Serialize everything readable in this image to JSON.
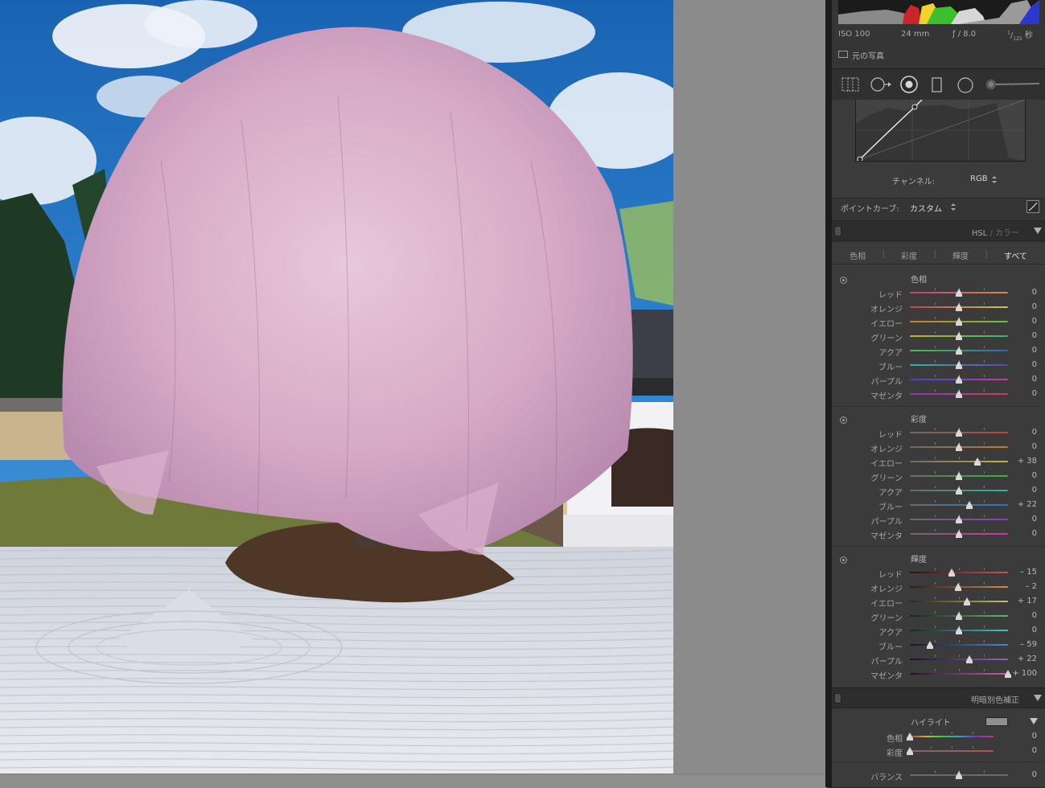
{
  "info": {
    "iso": "ISO 100",
    "focal": "24 mm",
    "aperture": "ƒ / 8.0",
    "shutter_num": "1",
    "shutter_den": "125",
    "shutter_unit": "秒",
    "original_label": "元の写真"
  },
  "tone_curve": {
    "channel_label": "チャンネル:",
    "channel_value": "RGB",
    "point_curve_label": "ポイントカーブ:",
    "point_curve_value": "カスタム"
  },
  "hsl": {
    "title_hsl": "HSL",
    "title_sep": " / ",
    "title_color": "カラー",
    "tabs": [
      "色相",
      "彩度",
      "輝度",
      "すべて"
    ],
    "groups": [
      {
        "title": "色相",
        "rows": [
          {
            "name": "レッド",
            "value": "0",
            "level": 0,
            "grad": [
              "#c23a7c",
              "#d98b3a"
            ]
          },
          {
            "name": "オレンジ",
            "value": "0",
            "level": 0,
            "grad": [
              "#c83a55",
              "#d9c23a"
            ]
          },
          {
            "name": "イエロー",
            "value": "0",
            "level": 0,
            "grad": [
              "#d07a2c",
              "#6cc23a"
            ]
          },
          {
            "name": "グリーン",
            "value": "0",
            "level": 0,
            "grad": [
              "#c9b22c",
              "#2cb87a"
            ]
          },
          {
            "name": "アクア",
            "value": "0",
            "level": 0,
            "grad": [
              "#4cc23a",
              "#2c66c2"
            ]
          },
          {
            "name": "ブルー",
            "value": "0",
            "level": 0,
            "grad": [
              "#2cb8a8",
              "#6a3ac2"
            ]
          },
          {
            "name": "パープル",
            "value": "0",
            "level": 0,
            "grad": [
              "#3a4ac2",
              "#c23aa2"
            ]
          },
          {
            "name": "マゼンタ",
            "value": "0",
            "level": 0,
            "grad": [
              "#8a3ac2",
              "#d23a5a"
            ]
          }
        ]
      },
      {
        "title": "彩度",
        "rows": [
          {
            "name": "レッド",
            "value": "0",
            "level": 0,
            "grad": [
              "#6a6a6a",
              "#c2443a"
            ]
          },
          {
            "name": "オレンジ",
            "value": "0",
            "level": 0,
            "grad": [
              "#6a6a6a",
              "#c8782c"
            ]
          },
          {
            "name": "イエロー",
            "value": "+ 38",
            "level": 38,
            "grad": [
              "#6a6a6a",
              "#c8b42c"
            ]
          },
          {
            "name": "グリーン",
            "value": "0",
            "level": 0,
            "grad": [
              "#6a6a6a",
              "#3cb43a"
            ]
          },
          {
            "name": "アクア",
            "value": "0",
            "level": 0,
            "grad": [
              "#6a6a6a",
              "#2cb49e"
            ]
          },
          {
            "name": "ブルー",
            "value": "+ 22",
            "level": 22,
            "grad": [
              "#6a6a6a",
              "#2c72c8"
            ]
          },
          {
            "name": "パープル",
            "value": "0",
            "level": 0,
            "grad": [
              "#6a6a6a",
              "#8a3ac8"
            ]
          },
          {
            "name": "マゼンタ",
            "value": "0",
            "level": 0,
            "grad": [
              "#6a6a6a",
              "#c83aa0"
            ]
          }
        ]
      },
      {
        "title": "輝度",
        "rows": [
          {
            "name": "レッド",
            "value": "– 15",
            "level": -15,
            "grad": [
              "#2a1212",
              "#c25a5a"
            ]
          },
          {
            "name": "オレンジ",
            "value": "– 2",
            "level": -2,
            "grad": [
              "#2a1e10",
              "#d09048"
            ]
          },
          {
            "name": "イエロー",
            "value": "+ 17",
            "level": 17,
            "grad": [
              "#2a2810",
              "#cec25a"
            ]
          },
          {
            "name": "グリーン",
            "value": "0",
            "level": 0,
            "grad": [
              "#122a12",
              "#5ac25a"
            ]
          },
          {
            "name": "アクア",
            "value": "0",
            "level": 0,
            "grad": [
              "#102a26",
              "#4ec2b0"
            ]
          },
          {
            "name": "ブルー",
            "value": "– 59",
            "level": -59,
            "grad": [
              "#10182a",
              "#4a8ad0"
            ]
          },
          {
            "name": "パープル",
            "value": "+ 22",
            "level": 22,
            "grad": [
              "#1c102a",
              "#9a5ad0"
            ]
          },
          {
            "name": "マゼンタ",
            "value": "+ 100",
            "level": 100,
            "grad": [
              "#2a1024",
              "#d05ab0"
            ]
          }
        ]
      }
    ]
  },
  "split_toning": {
    "title": "明暗別色補正",
    "highlight_label": "ハイライト",
    "highlight_swatch": "#8e8e8e",
    "rows": [
      {
        "name": "色相",
        "value": "0",
        "level": -100,
        "grad": [
          "#c23a3a",
          "#c2b83a",
          "#3ac24a",
          "#3a9ac2",
          "#6a3ac2",
          "#c23a8a"
        ]
      },
      {
        "name": "彩度",
        "value": "0",
        "level": -100,
        "grad": [
          "#7a6a6a",
          "#c24a4a"
        ]
      }
    ],
    "balance_label": "バランス",
    "balance_value": "0",
    "balance_level": 0
  }
}
